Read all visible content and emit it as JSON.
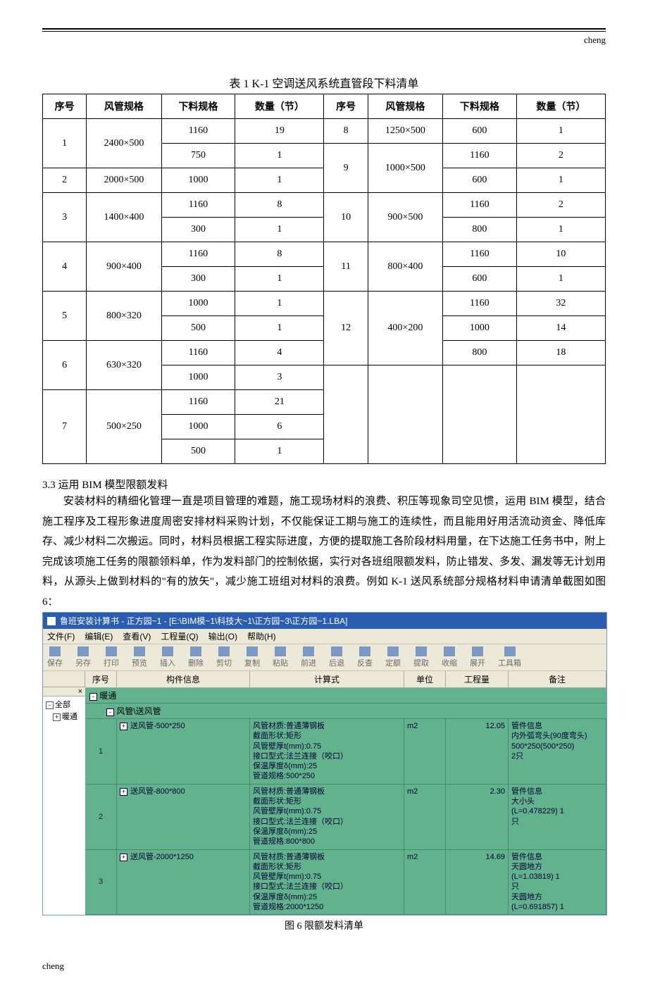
{
  "header_right": "cheng",
  "footer_left": "cheng",
  "table_title": "表 1   K-1 空调送风系统直管段下料清单",
  "columns": [
    "序号",
    "风管规格",
    "下料规格",
    "数量（节）",
    "序号",
    "风管规格",
    "下料规格",
    "数量（节）"
  ],
  "rows": [
    [
      "1",
      "2400×500",
      "1160",
      "19",
      "8",
      "1250×500",
      "600",
      "1"
    ],
    [
      "",
      "",
      "750",
      "1",
      "9",
      "1000×500",
      "1160",
      "2"
    ],
    [
      "2",
      "2000×500",
      "1000",
      "1",
      "",
      "",
      "600",
      "1"
    ],
    [
      "3",
      "1400×400",
      "1160",
      "8",
      "10",
      "900×500",
      "1160",
      "2"
    ],
    [
      "",
      "",
      "300",
      "1",
      "",
      "",
      "800",
      "1"
    ],
    [
      "4",
      "900×400",
      "1160",
      "8",
      "11",
      "800×400",
      "1160",
      "10"
    ],
    [
      "",
      "",
      "300",
      "1",
      "",
      "",
      "600",
      "1"
    ],
    [
      "5",
      "800×320",
      "1000",
      "1",
      "12",
      "400×200",
      "1160",
      "32"
    ],
    [
      "",
      "",
      "500",
      "1",
      "",
      "",
      "1000",
      "14"
    ],
    [
      "6",
      "630×320",
      "1160",
      "4",
      "",
      "",
      "800",
      "18"
    ],
    [
      "",
      "",
      "1000",
      "3",
      "",
      "",
      "",
      ""
    ],
    [
      "7",
      "500×250",
      "1160",
      "21",
      "",
      "",
      "",
      ""
    ],
    [
      "",
      "",
      "1000",
      "6",
      "",
      "",
      "",
      ""
    ],
    [
      "",
      "",
      "500",
      "1",
      "",
      "",
      "",
      ""
    ]
  ],
  "merge": {
    "0_0": 2,
    "0_1": 2,
    "3_0": 2,
    "3_1": 2,
    "5_0": 2,
    "5_1": 2,
    "7_0": 2,
    "7_1": 2,
    "9_0": 2,
    "9_1": 2,
    "11_0": 3,
    "11_1": 3,
    "1_4": 2,
    "1_5": 2,
    "3_4": 2,
    "3_5": 2,
    "5_4": 2,
    "5_5": 2,
    "7_4": 3,
    "7_5": 3,
    "10_4": 4,
    "10_5": 4,
    "10_6": 4,
    "10_7": 4
  },
  "section_title": "3.3 运用 BIM 模型限额发料",
  "paragraph": "安装材料的精细化管理一直是项目管理的难题，施工现场材料的浪费、积压等现象司空见惯，运用 BIM 模型，结合施工程序及工程形象进度周密安排材料采购计划，不仅能保证工期与施工的连续性，而且能用好用活流动资金、降低库存、减少材料二次搬运。同时，材料员根据工程实际进度，方便的提取施工各阶段材料用量，在下达施工任务书中，附上完成该项施工任务的限额领料单，作为发料部门的控制依据，实行对各班组限额发料，防止错发、多发、漏发等无计划用料，从源头上做到材料的\"有的放矢\"，减少施工班组对材料的浪费。例如 K-1 送风系统部分规格材料申请清单截图如图 6：",
  "fig_caption": "图 6 限额发料清单",
  "shot": {
    "title": "鲁班安装计算书 - 正方园~1 - [E:\\BIM模~1\\科技大~1\\正方园~3\\正方园~1.LBA]",
    "menus": [
      "文件(F)",
      "编辑(E)",
      "查看(V)",
      "工程量(Q)",
      "输出(O)",
      "帮助(H)"
    ],
    "tools": [
      "保存",
      "另存",
      "打印",
      "预览",
      "插入",
      "删除",
      "剪切",
      "复制",
      "粘贴",
      "前进",
      "后退",
      "反查",
      "定额",
      "提取",
      "收缩",
      "展开",
      "工具箱"
    ],
    "grid_headers": [
      "序号",
      "构件信息",
      "计算式",
      "单位",
      "工程量",
      "备注"
    ],
    "tree": {
      "root": "全部",
      "child": "暖通",
      "close_x": "×",
      "minus": "-",
      "plus": "+"
    },
    "group1": "暖通",
    "group2": "风管\\送风管",
    "items": [
      {
        "idx": "1",
        "comp": "送风管-500*250",
        "calc": "风管材质:普通薄钢板\n截面形状:矩形\n风管壁厚t(mm):0.75\n接口型式:法兰连接（咬口）\n保温厚度δ(mm):25\n管道规格:500*250",
        "unit": "m2",
        "qty": "12.05",
        "rmk": "管件信息\n内外弧弯头(90度弯头)\n500*250(500*250)\n2只"
      },
      {
        "idx": "2",
        "comp": "送风管-800*800",
        "calc": "风管材质:普通薄钢板\n截面形状:矩形\n风管壁厚t(mm):0.75\n接口型式:法兰连接（咬口）\n保温厚度δ(mm):25\n管道规格:800*800",
        "unit": "m2",
        "qty": "2.30",
        "rmk": "管件信息\n大小头\n(L=0.478229) 1\n只"
      },
      {
        "idx": "3",
        "comp": "送风管-2000*1250",
        "calc": "风管材质:普通薄钢板\n截面形状:矩形\n风管壁厚t(mm):0.75\n接口型式:法兰连接（咬口）\n保温厚度δ(mm):25\n管道规格:2000*1250",
        "unit": "m2",
        "qty": "14.69",
        "rmk": "管件信息\n天圆地方\n(L=1.03819) 1\n只\n天圆地方\n(L=0.691857) 1"
      }
    ]
  }
}
